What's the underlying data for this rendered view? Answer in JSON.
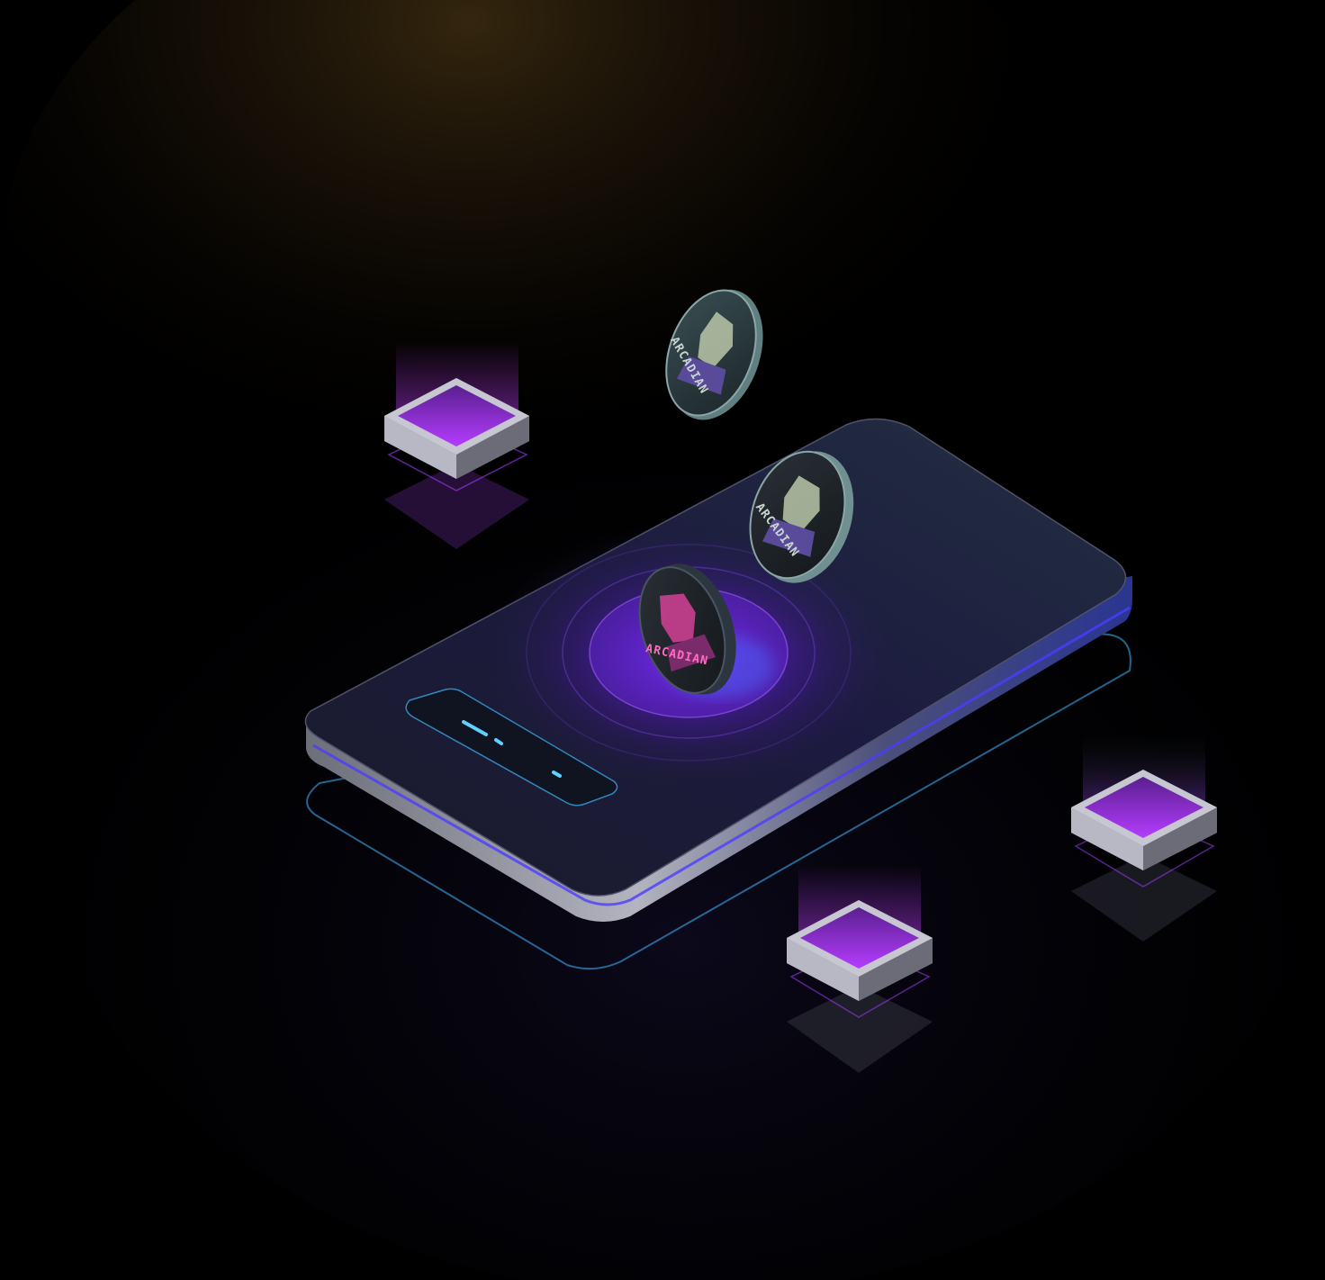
{
  "scene": {
    "colors": {
      "background": "#000000",
      "glow_warm": "#3a2a10",
      "glow_purple": "#7a2cff",
      "phone_body": "#1a1d2e",
      "phone_edge": "#8a8c98",
      "accent_cyan": "#3fb6ff",
      "block_purple": "#a23cff",
      "block_frame": "#a9aab5",
      "coin_teal": "#5f7f80",
      "coin_dark": "#1f2a2e",
      "coin_pink": "#e0439e"
    },
    "coins": [
      {
        "logo_text": "ARCADIAN",
        "tint": "teal"
      },
      {
        "logo_text": "ARCADIAN",
        "tint": "teal"
      },
      {
        "logo_text": "ARCADIAN",
        "tint": "pink"
      }
    ],
    "icons": [
      "phone-icon",
      "coin-icon",
      "block-icon",
      "status-bar-icon"
    ]
  }
}
